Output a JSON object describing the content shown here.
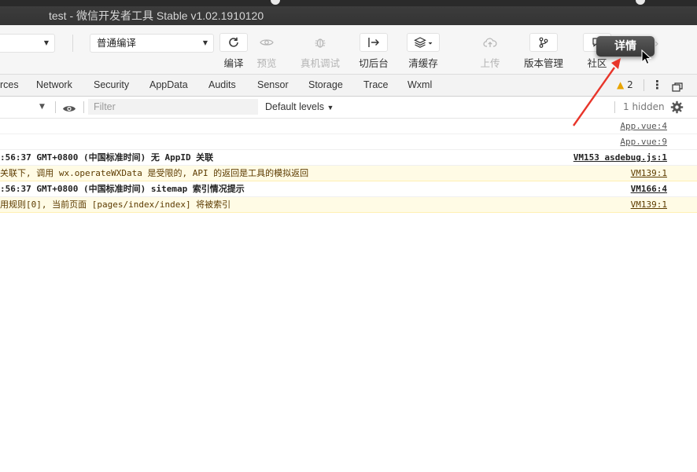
{
  "window": {
    "title": "test - 微信开发者工具 Stable v1.02.1910120"
  },
  "toolbar": {
    "compile_mode": "普通编译",
    "tools": [
      {
        "label": "编译",
        "icon": "refresh-icon"
      },
      {
        "label": "预览",
        "icon": "eye-icon"
      },
      {
        "label": "真机调试",
        "icon": "bug-icon"
      },
      {
        "label": "切后台",
        "icon": "switch-background-icon"
      },
      {
        "label": "清缓存",
        "icon": "layers-icon"
      },
      {
        "label": "上传",
        "icon": "cloud-upload-icon"
      },
      {
        "label": "版本管理",
        "icon": "branch-icon"
      },
      {
        "label": "社区",
        "icon": "chat-icon"
      }
    ],
    "tooltip": "详情"
  },
  "devtools": {
    "tabs": [
      "rces",
      "Network",
      "Security",
      "AppData",
      "Audits",
      "Sensor",
      "Storage",
      "Trace",
      "Wxml"
    ],
    "warning_count": "2"
  },
  "filter": {
    "placeholder": "Filter",
    "levels": "Default levels",
    "hidden": "1 hidden"
  },
  "console": {
    "rows": [
      {
        "message": "",
        "source": "App.vue:4"
      },
      {
        "message": "",
        "source": "App.vue:9"
      },
      {
        "message": ":56:37 GMT+0800 (中国标准时间) 无 AppID 关联",
        "source": "VM153 asdebug.js:1"
      },
      {
        "message": "关联下, 调用 wx.operateWXData 是受限的, API 的返回是工具的模拟返回",
        "source": "VM139:1"
      },
      {
        "message": ":56:37 GMT+0800 (中国标准时间) sitemap 索引情况提示",
        "source": "VM166:4"
      },
      {
        "message": "用规则[0], 当前页面 [pages/index/index] 将被索引",
        "source": "VM139:1"
      }
    ]
  },
  "colors": {
    "annotation_arrow": "#e8352a",
    "warning_bg": "#fffbe5",
    "tooltip_bg": "#3a3a3a"
  }
}
